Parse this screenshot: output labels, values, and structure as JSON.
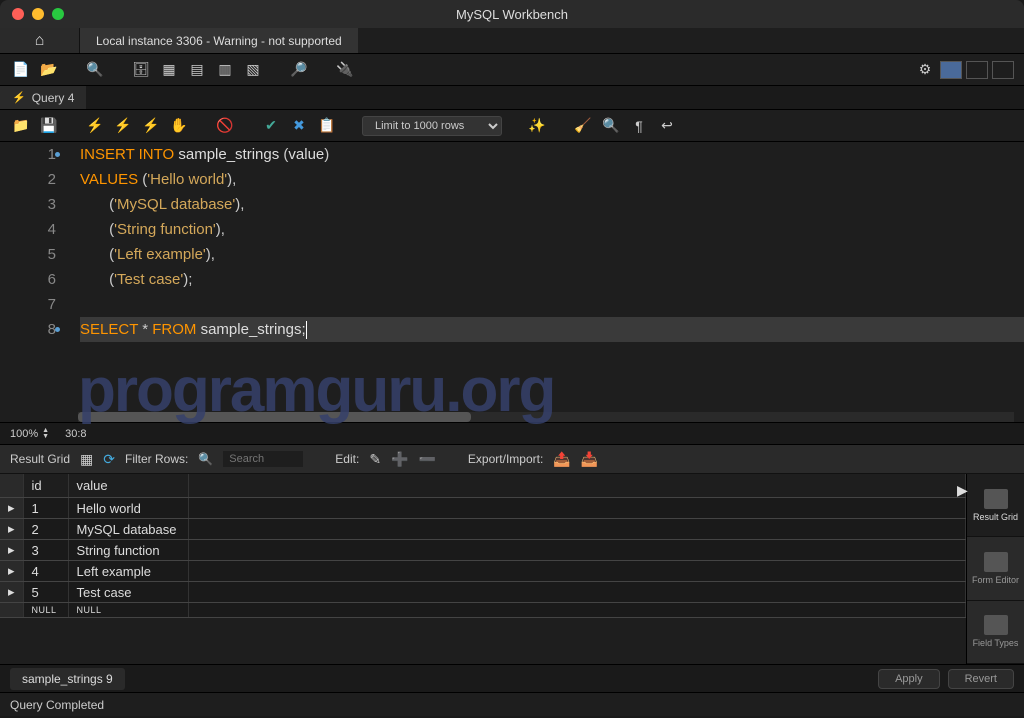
{
  "title": "MySQL Workbench",
  "connection_tab": "Local instance 3306 - Warning - not supported",
  "query_tab": "Query 4",
  "limit_select": "Limit to 1000 rows",
  "editor": {
    "lines": [
      {
        "n": 1,
        "marker": true,
        "tokens": [
          {
            "t": "INSERT INTO ",
            "c": "kw"
          },
          {
            "t": "sample_strings ",
            "c": "ident"
          },
          {
            "t": "(",
            "c": "punct"
          },
          {
            "t": "value",
            "c": "ident"
          },
          {
            "t": ")",
            "c": "punct"
          }
        ]
      },
      {
        "n": 2,
        "marker": false,
        "tokens": [
          {
            "t": "VALUES ",
            "c": "kw"
          },
          {
            "t": "(",
            "c": "punct"
          },
          {
            "t": "'Hello world'",
            "c": "str"
          },
          {
            "t": "),",
            "c": "punct"
          }
        ]
      },
      {
        "n": 3,
        "marker": false,
        "tokens": [
          {
            "t": "       (",
            "c": "punct"
          },
          {
            "t": "'MySQL database'",
            "c": "str"
          },
          {
            "t": "),",
            "c": "punct"
          }
        ]
      },
      {
        "n": 4,
        "marker": false,
        "tokens": [
          {
            "t": "       (",
            "c": "punct"
          },
          {
            "t": "'String function'",
            "c": "str"
          },
          {
            "t": "),",
            "c": "punct"
          }
        ]
      },
      {
        "n": 5,
        "marker": false,
        "tokens": [
          {
            "t": "       (",
            "c": "punct"
          },
          {
            "t": "'Left example'",
            "c": "str"
          },
          {
            "t": "),",
            "c": "punct"
          }
        ]
      },
      {
        "n": 6,
        "marker": false,
        "tokens": [
          {
            "t": "       (",
            "c": "punct"
          },
          {
            "t": "'Test case'",
            "c": "str"
          },
          {
            "t": ");",
            "c": "punct"
          }
        ]
      },
      {
        "n": 7,
        "marker": false,
        "tokens": []
      },
      {
        "n": 8,
        "marker": true,
        "highlighted": true,
        "tokens": [
          {
            "t": "SELECT ",
            "c": "kw"
          },
          {
            "t": "* ",
            "c": "punct"
          },
          {
            "t": "FROM ",
            "c": "kw"
          },
          {
            "t": "sample_strings;",
            "c": "ident"
          }
        ],
        "cursor": true
      }
    ]
  },
  "zoom": "100%",
  "cursor_pos": "30:8",
  "result_toolbar": {
    "label": "Result Grid",
    "filter_label": "Filter Rows:",
    "filter_placeholder": "Search",
    "edit_label": "Edit:",
    "export_label": "Export/Import:"
  },
  "result_grid": {
    "columns": [
      "id",
      "value"
    ],
    "rows": [
      {
        "id": "1",
        "value": "Hello world"
      },
      {
        "id": "2",
        "value": "MySQL database"
      },
      {
        "id": "3",
        "value": "String function"
      },
      {
        "id": "4",
        "value": "Left example"
      },
      {
        "id": "5",
        "value": "Test case"
      }
    ],
    "null_label": "NULL"
  },
  "result_sidebar": {
    "grid": "Result Grid",
    "form": "Form Editor",
    "field": "Field Types"
  },
  "result_tab": "sample_strings 9",
  "apply_btn": "Apply",
  "revert_btn": "Revert",
  "status": "Query Completed",
  "watermark": "programguru.org"
}
